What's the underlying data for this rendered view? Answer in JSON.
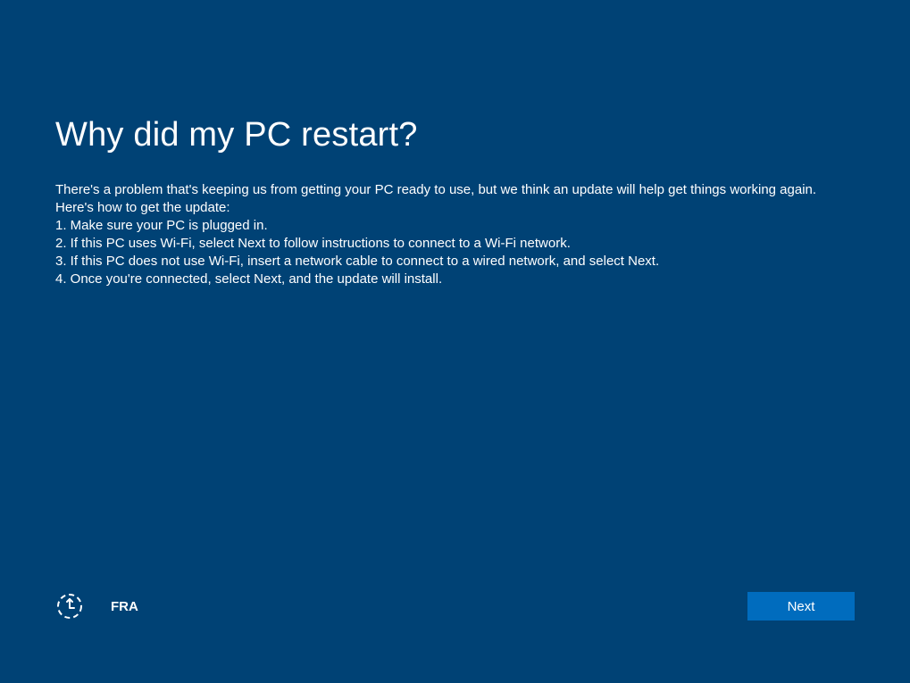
{
  "title": "Why did my PC restart?",
  "body": {
    "intro": "There's a problem that's keeping us from getting your PC ready to use, but we think an update will help get things working again.",
    "howto": "Here's how to get the update:",
    "step1": "1. Make sure your PC is plugged in.",
    "step2": "2. If this PC uses Wi-Fi, select Next to follow instructions to connect to a Wi-Fi network.",
    "step3": "3. If this PC does not use Wi-Fi, insert a network cable to connect to a wired network, and select Next.",
    "step4": "4. Once you're connected, select Next, and the update will install."
  },
  "footer": {
    "language": "FRA",
    "next_label": "Next"
  }
}
